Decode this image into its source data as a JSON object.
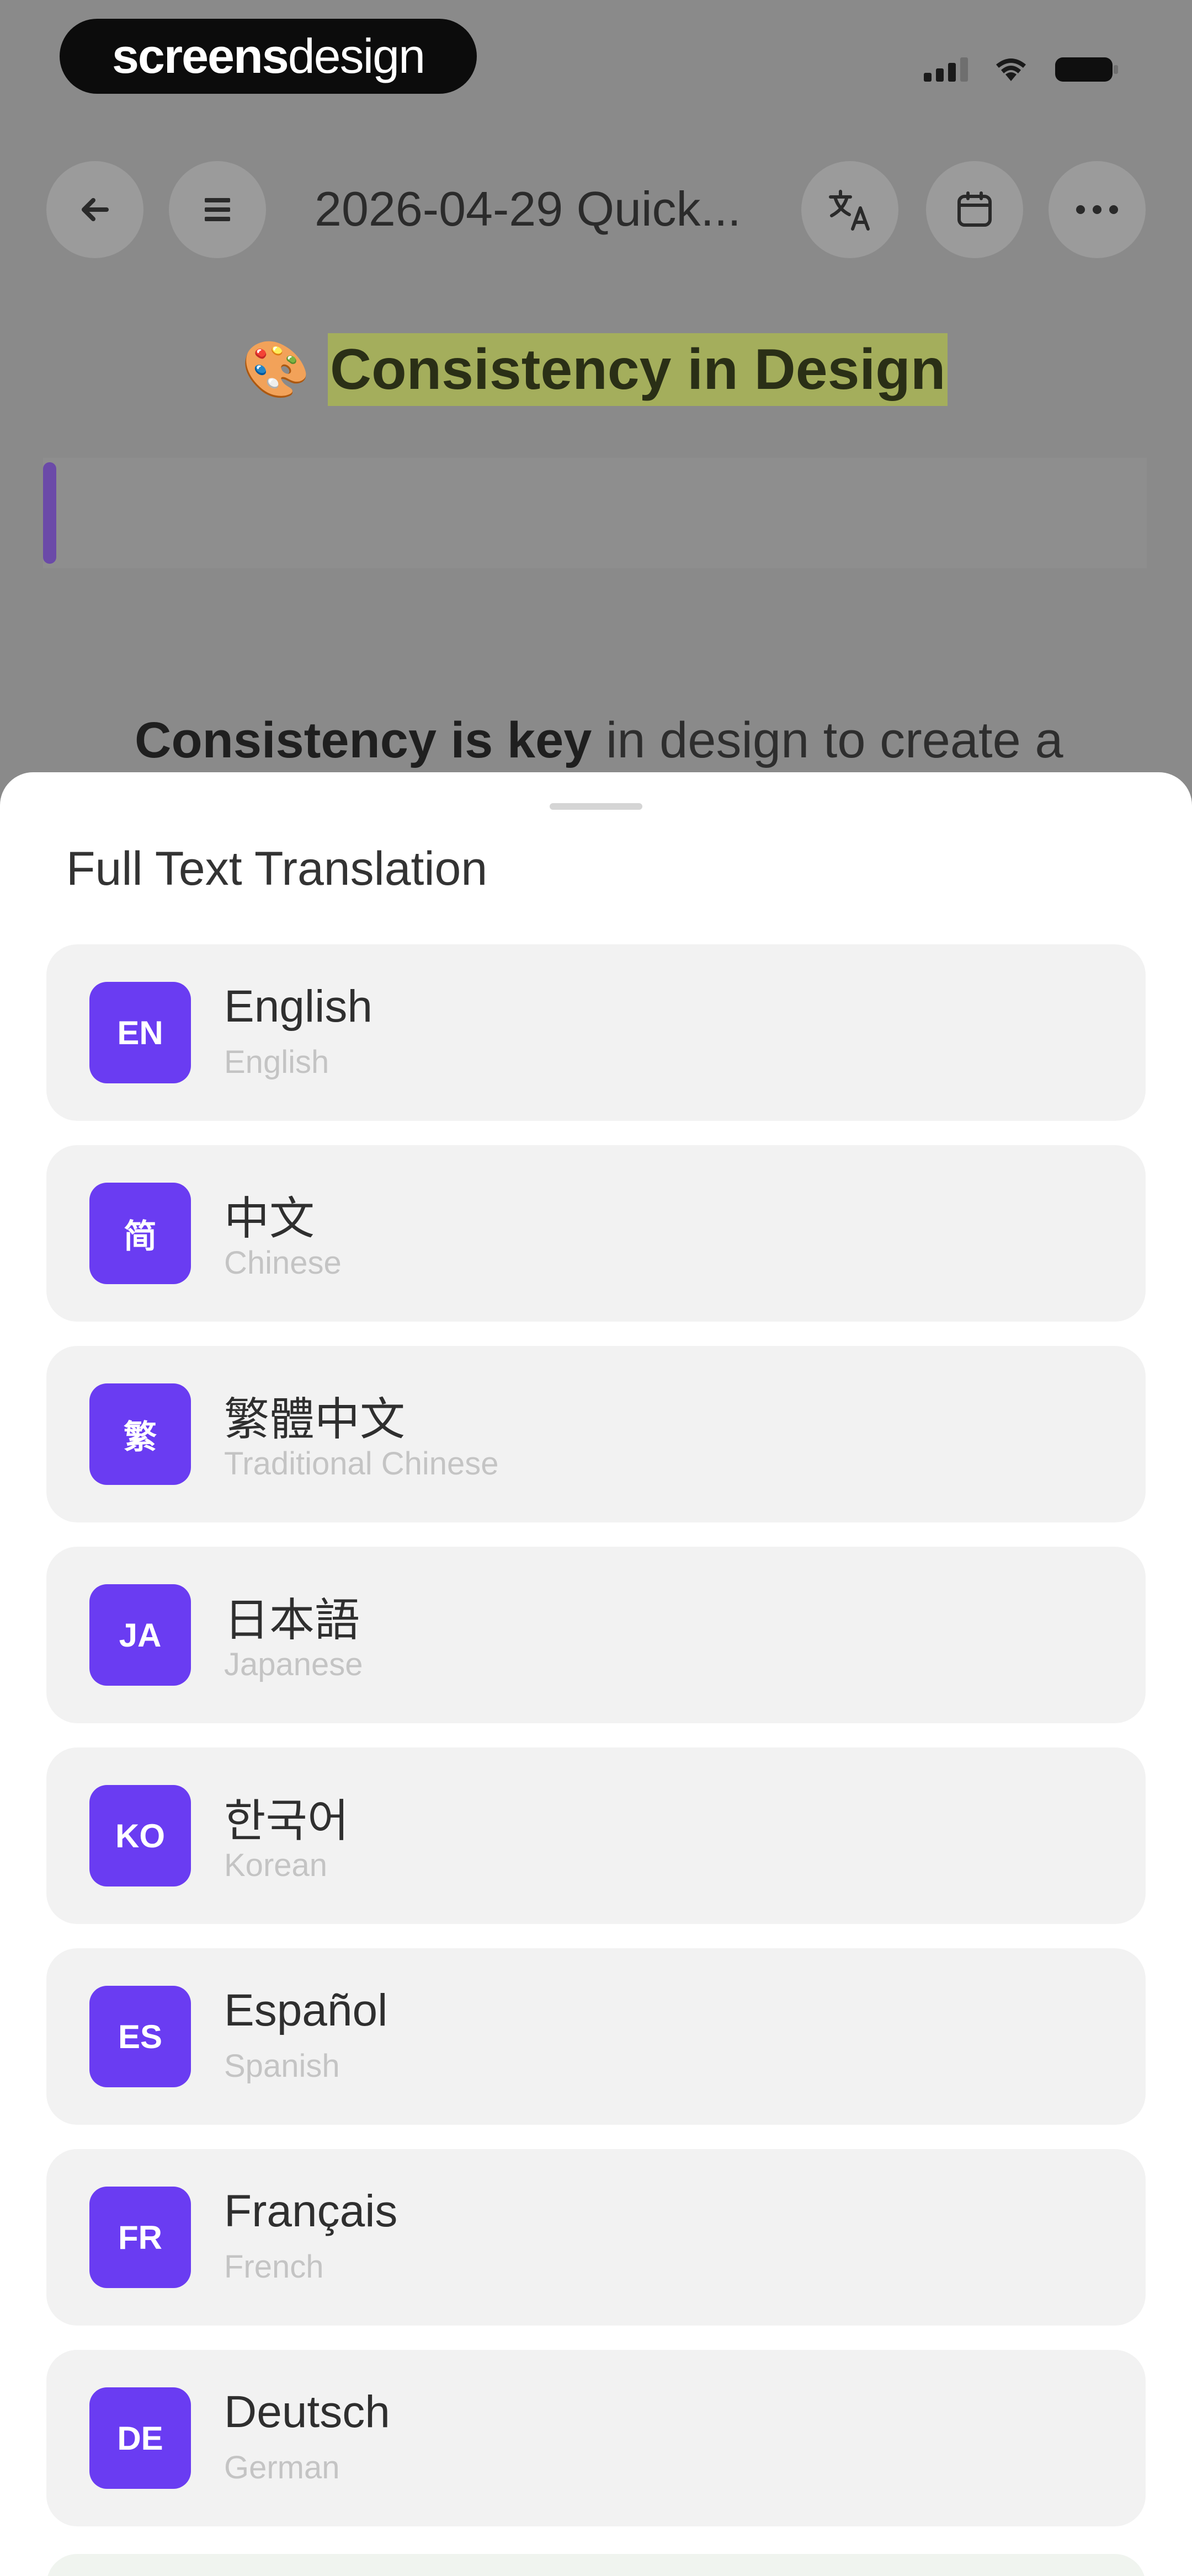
{
  "status_bar": {
    "brand_bold": "screens",
    "brand_light": "design"
  },
  "toolbar": {
    "title": "2026-04-29 Quick..."
  },
  "document": {
    "heading_emoji": "🎨",
    "heading": "Consistency in Design",
    "paragraph_bold": "Consistency is key",
    "paragraph_rest": " in design to create a"
  },
  "sheet": {
    "title": "Full Text Translation",
    "languages": [
      {
        "code": "EN",
        "native": "English",
        "english": "English"
      },
      {
        "code": "简",
        "native": "中文",
        "english": "Chinese"
      },
      {
        "code": "繁",
        "native": "繁體中文",
        "english": "Traditional Chinese"
      },
      {
        "code": "JA",
        "native": "日本語",
        "english": "Japanese"
      },
      {
        "code": "KO",
        "native": "한국어",
        "english": "Korean"
      },
      {
        "code": "ES",
        "native": "Español",
        "english": "Spanish"
      },
      {
        "code": "FR",
        "native": "Français",
        "english": "French"
      },
      {
        "code": "DE",
        "native": "Deutsch",
        "english": "German"
      }
    ]
  },
  "colors": {
    "accent": "#6a3cf2",
    "highlight": "#a4ae5c",
    "callout_bar": "#6b4aa8",
    "overlay": "#8a8a8a"
  },
  "icons": {
    "back": "arrow-left-icon",
    "outline": "list-icon",
    "translate": "translate-icon",
    "calendar": "calendar-icon",
    "more": "more-horizontal-icon"
  }
}
